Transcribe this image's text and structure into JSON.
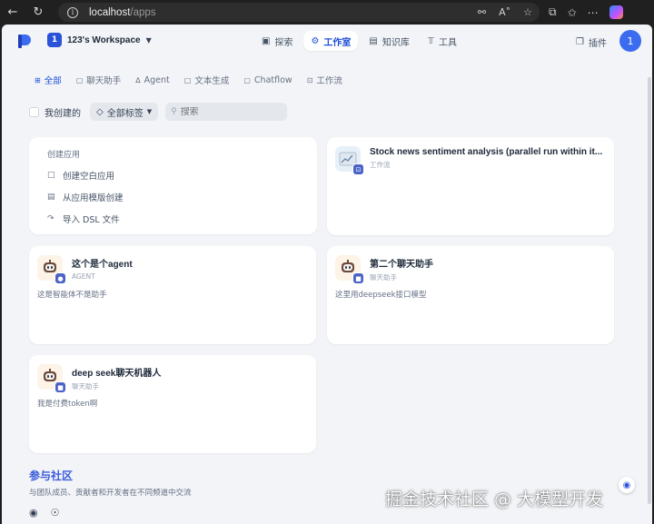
{
  "browser": {
    "url_host": "localhost",
    "url_path": "/apps"
  },
  "workspace": {
    "avatar": "1",
    "name": "123's Workspace"
  },
  "nav": [
    {
      "label": "探索",
      "icon": "explore-icon",
      "active": false
    },
    {
      "label": "工作室",
      "icon": "studio-icon",
      "active": true
    },
    {
      "label": "知识库",
      "icon": "knowledge-icon",
      "active": false
    },
    {
      "label": "工具",
      "icon": "tools-icon",
      "active": false
    }
  ],
  "plugins_label": "插件",
  "user_avatar": "1",
  "filter_tabs": [
    {
      "label": "全部",
      "active": true
    },
    {
      "label": "聊天助手",
      "active": false
    },
    {
      "label": "Agent",
      "active": false
    },
    {
      "label": "文本生成",
      "active": false
    },
    {
      "label": "Chatflow",
      "active": false
    },
    {
      "label": "工作流",
      "active": false
    }
  ],
  "filters": {
    "mine": "我创建的",
    "tags": "全部标签",
    "search_placeholder": "搜索"
  },
  "create": {
    "title": "创建应用",
    "blank": "创建空白应用",
    "template": "从应用模版创建",
    "import": "导入 DSL 文件"
  },
  "apps": [
    {
      "name": "Stock news sentiment analysis (parallel run within it...",
      "type": "工作流",
      "desc": ""
    },
    {
      "name": "这个是个agent",
      "type": "AGENT",
      "desc": "这是智能体不是助手"
    },
    {
      "name": "第二个聊天助手",
      "type": "聊天助手",
      "desc": "这里用deepseek接口模型"
    },
    {
      "name": "deep seek聊天机器人",
      "type": "聊天助手",
      "desc": "我是付费token啊"
    }
  ],
  "community": {
    "title": "参与社区",
    "subtitle": "与团队成员、贡献者和开发者在不同频道中交流"
  },
  "watermark": "掘金技术社区 @ 大模型开发",
  "colors": {
    "accent": "#1d4ed8",
    "page_bg": "#f2f4f7",
    "badge": "#4b63c6"
  }
}
